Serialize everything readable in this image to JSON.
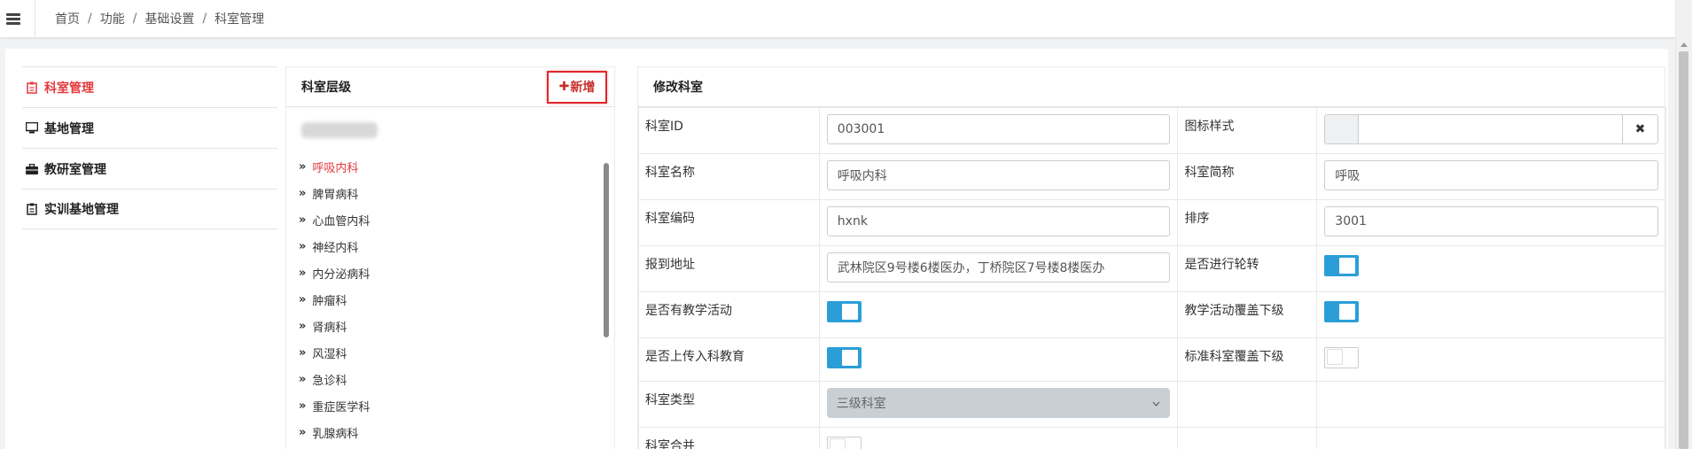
{
  "breadcrumb": [
    "首页",
    "功能",
    "基础设置",
    "科室管理"
  ],
  "leftnav": {
    "items": [
      {
        "label": "科室管理",
        "icon": "clipboard-icon",
        "active": true
      },
      {
        "label": "基地管理",
        "icon": "monitor-icon",
        "active": false
      },
      {
        "label": "教研室管理",
        "icon": "briefcase-icon",
        "active": false
      },
      {
        "label": "实训基地管理",
        "icon": "clipboard-icon",
        "active": false
      }
    ]
  },
  "tree": {
    "title": "科室层级",
    "add_label": "新增",
    "add_icon": "plus-icon",
    "arrow": "»",
    "items": [
      "呼吸内科",
      "脾胃病科",
      "心血管内科",
      "神经内科",
      "内分泌病科",
      "肿瘤科",
      "肾病科",
      "风湿科",
      "急诊科",
      "重症医学科",
      "乳腺病科"
    ]
  },
  "form": {
    "title": "修改科室",
    "dept_id_label": "科室ID",
    "dept_id_value": "003001",
    "icon_style_label": "图标样式",
    "icon_style_value": "",
    "clear_label": "✖",
    "dept_name_label": "科室名称",
    "dept_name_value": "呼吸内科",
    "dept_short_label": "科室简称",
    "dept_short_value": "呼吸",
    "dept_code_label": "科室编码",
    "dept_code_value": "hxnk",
    "sort_label": "排序",
    "sort_value": "3001",
    "address_label": "报到地址",
    "address_value": "武林院区9号楼6楼医办，丁桥院区7号楼8楼医办",
    "rotation_label": "是否进行轮转",
    "rotation_on": true,
    "teaching_label": "是否有教学活动",
    "teaching_on": true,
    "teaching_cover_label": "教学活动覆盖下级",
    "teaching_cover_on": true,
    "upload_label": "是否上传入科教育",
    "upload_on": true,
    "std_cover_label": "标准科室覆盖下级",
    "std_cover_on": false,
    "dept_type_label": "科室类型",
    "dept_type_value": "三级科室",
    "merge_label": "科室合并",
    "merge_on": false
  },
  "colors": {
    "accent": "#e4393c",
    "toggle_on": "#2b9ed8"
  }
}
